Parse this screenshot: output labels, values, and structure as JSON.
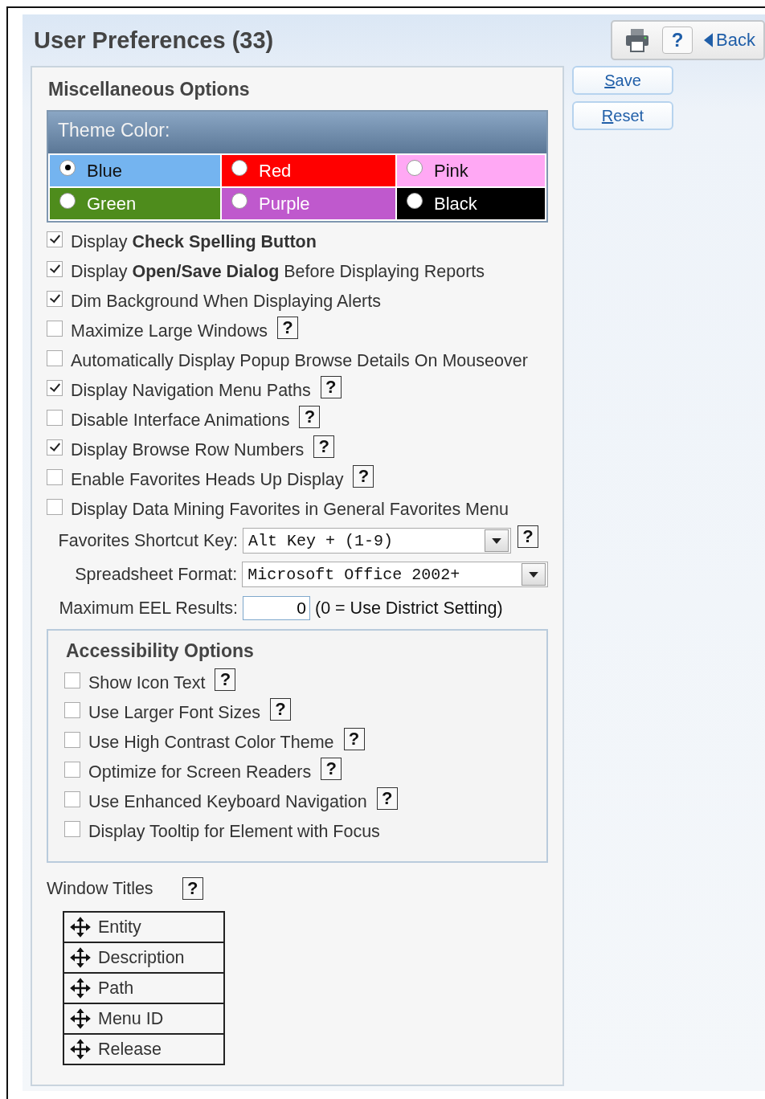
{
  "title": "User Preferences (33)",
  "header_buttons": {
    "help": "?",
    "back": "Back"
  },
  "actions": [
    {
      "label": "Save"
    },
    {
      "label": "Reset"
    }
  ],
  "misc": {
    "title": "Miscellaneous Options",
    "theme": {
      "title": "Theme Color:",
      "options": [
        {
          "label": "Blue",
          "color": "#74b4f0",
          "selected": true
        },
        {
          "label": "Red",
          "color": "#ff0000",
          "selected": false
        },
        {
          "label": "Pink",
          "color": "#ffa8f4",
          "selected": false
        },
        {
          "label": "Green",
          "color": "#4e8c1c",
          "selected": false
        },
        {
          "label": "Purple",
          "color": "#bf59cd",
          "selected": false
        },
        {
          "label": "Black",
          "color": "#000000",
          "selected": false
        }
      ]
    },
    "options": [
      {
        "label": "Display **Check Spelling Button**",
        "checked": true
      },
      {
        "label": "Display **Open/Save Dialog** Before Displaying Reports",
        "checked": true
      },
      {
        "label": "Dim Background When Displaying Alerts",
        "checked": true
      },
      {
        "label": "Maximize Large Windows",
        "checked": false,
        "help": "?"
      },
      {
        "label": "Automatically Display Popup Browse Details On Mouseover",
        "checked": false
      },
      {
        "label": "Display Navigation Menu Paths",
        "checked": true,
        "help": "?"
      },
      {
        "label": "Disable Interface Animations",
        "checked": false,
        "help": "?"
      },
      {
        "label": "Display Browse Row Numbers",
        "checked": true,
        "help": "?"
      },
      {
        "label": "Enable Favorites Heads Up Display",
        "checked": false,
        "help": "?"
      },
      {
        "label": "Display Data Mining Favorites in General Favorites Menu",
        "checked": false
      }
    ],
    "fields": [
      {
        "kind": "select",
        "label": "Favorites Shortcut Key:",
        "value": "Alt Key + (1-9)",
        "help": "?"
      },
      {
        "kind": "select",
        "label": "Spreadsheet Format:",
        "value": "Microsoft Office 2002+"
      },
      {
        "kind": "number",
        "label": "Maximum EEL Results:",
        "value": "0",
        "note": "(0 = Use District Setting)"
      }
    ]
  },
  "accessibility": {
    "title": "Accessibility Options",
    "options": [
      {
        "label": "Show Icon Text",
        "checked": false,
        "help": "?"
      },
      {
        "label": "Use Larger Font Sizes",
        "checked": false,
        "help": "?"
      },
      {
        "label": "Use High Contrast Color Theme",
        "checked": false,
        "help": "?"
      },
      {
        "label": "Optimize for Screen Readers",
        "checked": false,
        "help": "?"
      },
      {
        "label": "Use Enhanced Keyboard Navigation",
        "checked": false,
        "help": "?"
      },
      {
        "label": "Display Tooltip for Element with Focus",
        "checked": false
      }
    ]
  },
  "window_titles": {
    "title": "Window Titles",
    "help": "?",
    "items": [
      {
        "label": "Entity"
      },
      {
        "label": "Description"
      },
      {
        "label": "Path"
      },
      {
        "label": "Menu ID"
      },
      {
        "label": "Release"
      }
    ]
  }
}
